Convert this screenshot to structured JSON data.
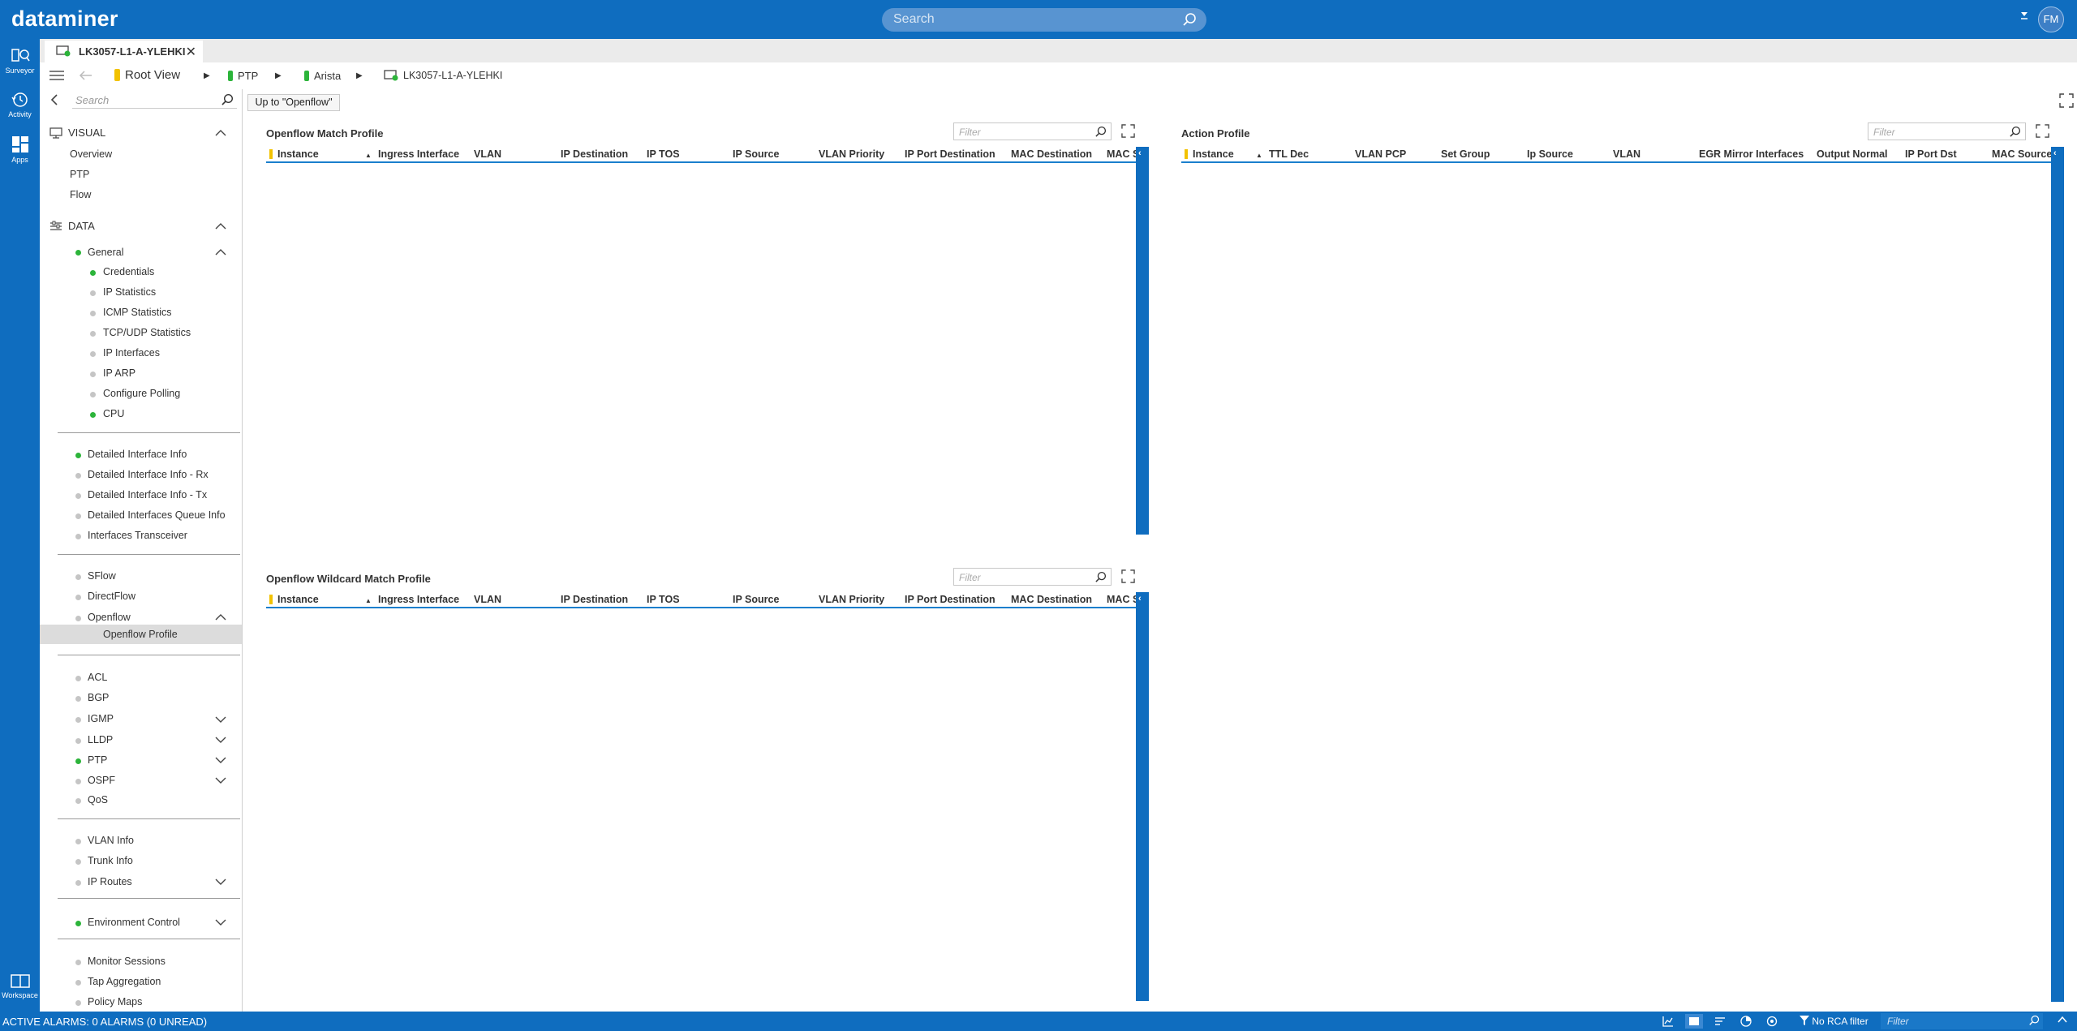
{
  "app": {
    "logo": "dataminer",
    "search_placeholder": "Search",
    "avatar_initials": "FM"
  },
  "rail": {
    "items": [
      {
        "label": "Surveyor"
      },
      {
        "label": "Activity"
      },
      {
        "label": "Apps"
      }
    ],
    "workspace": "Workspace"
  },
  "tab": {
    "title": "LK3057-L1-A-YLEHKI"
  },
  "breadcrumb": {
    "items": [
      "Root View",
      "PTP",
      "Arista",
      "LK3057-L1-A-YLEHKI"
    ]
  },
  "sidebar": {
    "search_placeholder": "Search",
    "visual": {
      "label": "VISUAL",
      "items": [
        "Overview",
        "PTP",
        "Flow"
      ]
    },
    "data": {
      "label": "DATA"
    },
    "general": {
      "label": "General",
      "items": [
        "Credentials",
        "IP Statistics",
        "ICMP Statistics",
        "TCP/UDP Statistics",
        "IP Interfaces",
        "IP ARP",
        "Configure Polling",
        "CPU"
      ]
    },
    "group2": [
      "Detailed Interface Info",
      "Detailed Interface Info - Rx",
      "Detailed Interface Info - Tx",
      "Detailed Interfaces Queue Info",
      "Interfaces Transceiver"
    ],
    "group3": [
      "SFlow",
      "DirectFlow",
      "Openflow"
    ],
    "openflow_child": "Openflow Profile",
    "group4": [
      "ACL",
      "BGP",
      "IGMP",
      "LLDP",
      "PTP",
      "OSPF",
      "QoS"
    ],
    "group5": [
      "VLAN Info",
      "Trunk Info",
      "IP Routes"
    ],
    "group6": [
      "Environment Control"
    ],
    "group7": [
      "Monitor Sessions",
      "Tap Aggregation",
      "Policy Maps"
    ]
  },
  "main": {
    "up_button": "Up to \"Openflow\"",
    "filter_placeholder": "Filter",
    "match_profile": {
      "title": "Openflow Match Profile",
      "columns": [
        "Instance",
        "Ingress Interface",
        "VLAN",
        "IP Destination",
        "IP TOS",
        "IP Source",
        "VLAN Priority",
        "IP Port Destination",
        "MAC Destination",
        "MAC Source"
      ]
    },
    "wildcard_profile": {
      "title": "Openflow Wildcard Match Profile",
      "columns": [
        "Instance",
        "Ingress Interface",
        "VLAN",
        "IP Destination",
        "IP TOS",
        "IP Source",
        "VLAN Priority",
        "IP Port Destination",
        "MAC Destination",
        "MAC Source"
      ]
    },
    "action_profile": {
      "title": "Action Profile",
      "columns": [
        "Instance",
        "TTL Dec",
        "VLAN PCP",
        "Set Group",
        "Ip Source",
        "VLAN",
        "EGR Mirror Interfaces",
        "Output Normal",
        "IP Port Dst",
        "MAC Source"
      ]
    }
  },
  "status": {
    "alarms": "ACTIVE ALARMS: 0 ALARMS (0 UNREAD)",
    "rca": "No RCA filter",
    "filter_placeholder": "Filter"
  },
  "colors": {
    "brand": "#0f6dbf",
    "accent_line": "#1a7fcd",
    "ok": "#2cb43a"
  }
}
